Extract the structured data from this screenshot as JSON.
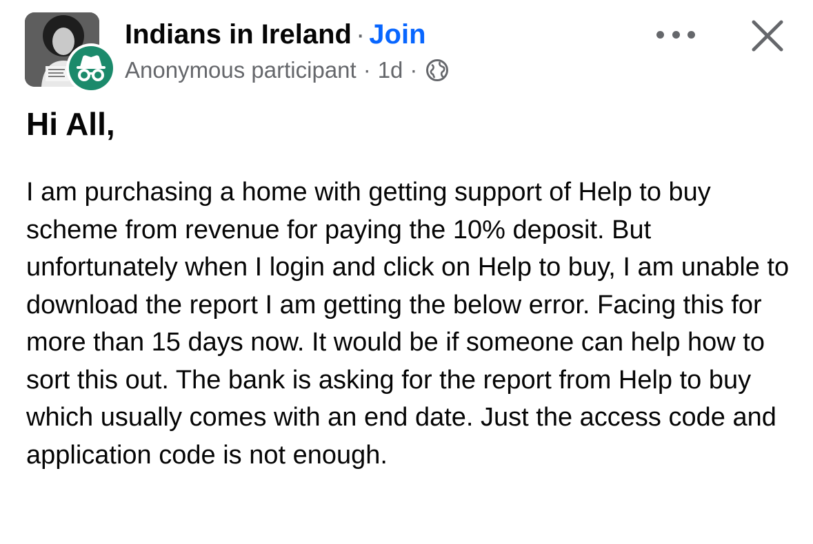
{
  "header": {
    "group_name": "Indians in Ireland",
    "separator": "·",
    "join_label": "Join",
    "author": "Anonymous participant",
    "time_ago": "1d",
    "avatar_icon": "group-photo",
    "badge_icon": "anonymous-incognito-icon",
    "badge_color": "#1b8a6b",
    "privacy_icon": "globe-icon",
    "more_icon": "more-options-icon",
    "close_icon": "close-icon",
    "join_color": "#0866ff"
  },
  "post": {
    "title": "Hi All,",
    "body": "I am purchasing a home with getting support of Help to buy scheme from revenue for paying the 10% deposit. But unfortunately when I login and click on Help to buy, I am unable to download the report I am getting the below error. Facing this for more than 15 days now. It would be if someone can help how to sort this out. The bank is asking for the report from Help to buy which usually comes with an end date. Just the access code and application code is not enough."
  }
}
